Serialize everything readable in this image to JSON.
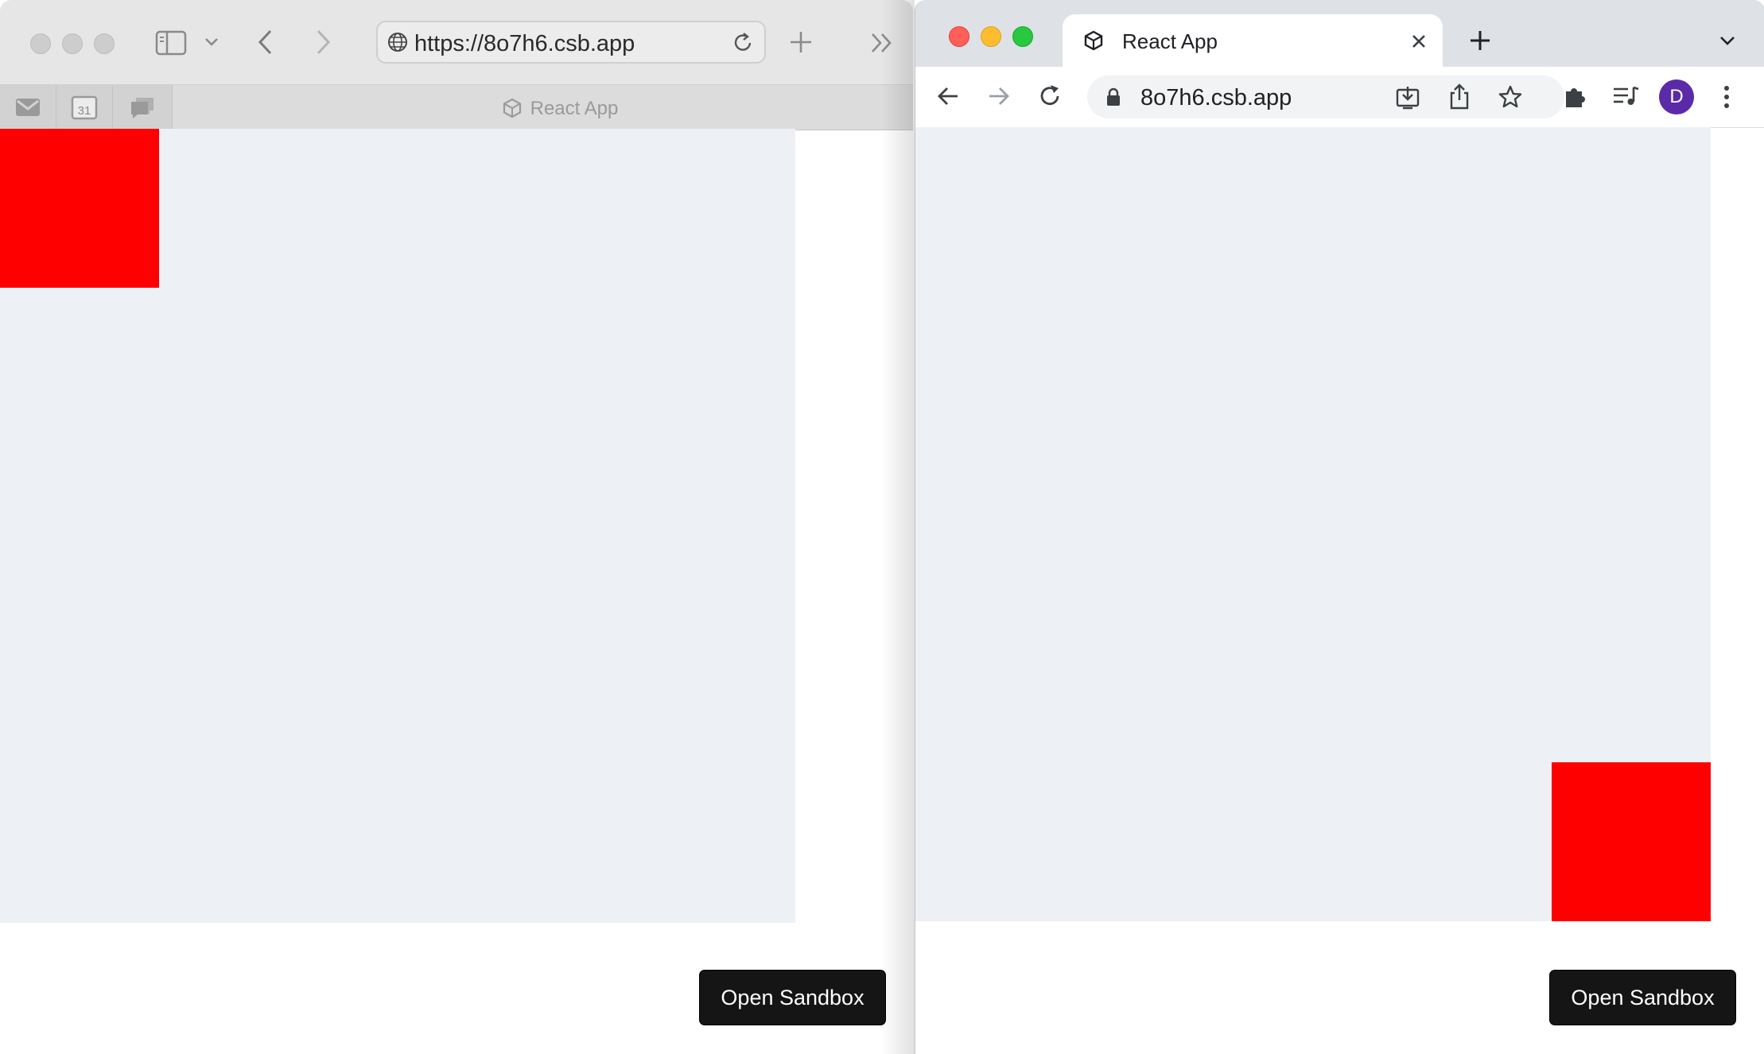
{
  "safari": {
    "url": "https://8o7h6.csb.app",
    "tab_title": "React App",
    "open_sandbox_label": "Open Sandbox",
    "calendar_day": "31"
  },
  "chrome": {
    "tab_title": "React App",
    "url": "8o7h6.csb.app",
    "avatar_initial": "D",
    "open_sandbox_label": "Open Sandbox"
  },
  "colors": {
    "box": "#ff0000",
    "canvas": "#edf1f5",
    "button_bg": "#151515",
    "avatar_bg": "#5b2aa8"
  },
  "icons": {
    "safari": [
      "sidebar-icon",
      "chevron-down-icon",
      "back-icon",
      "forward-icon",
      "globe-icon",
      "reload-icon",
      "new-tab-icon",
      "overflow-icon",
      "gmail-icon",
      "calendar-icon",
      "chat-icon",
      "codesandbox-icon"
    ],
    "chrome": [
      "codesandbox-icon",
      "close-icon",
      "new-tab-icon",
      "tab-search-icon",
      "back-icon",
      "forward-icon",
      "reload-icon",
      "lock-icon",
      "install-icon",
      "share-icon",
      "star-icon",
      "extensions-icon",
      "reading-list-icon",
      "menu-icon"
    ]
  }
}
